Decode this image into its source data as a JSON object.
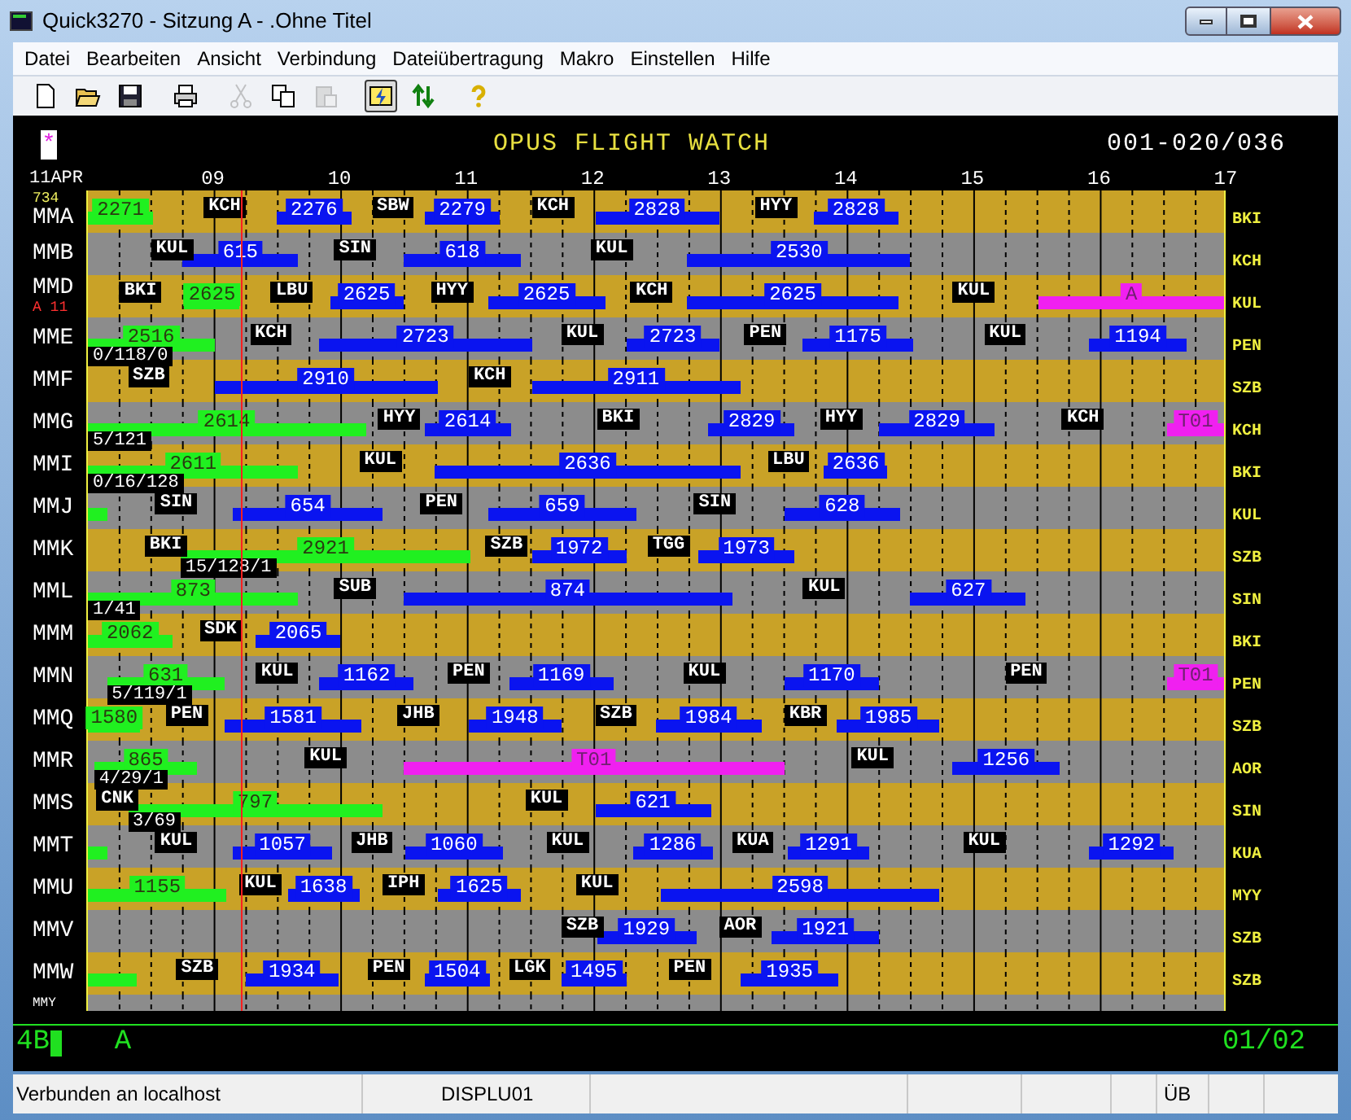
{
  "window": {
    "title": "Quick3270 - Sitzung A - .Ohne Titel"
  },
  "menu": [
    "Datei",
    "Bearbeiten",
    "Ansicht",
    "Verbindung",
    "Dateiübertragung",
    "Makro",
    "Einstellen",
    "Hilfe"
  ],
  "toolbar": [
    [
      {
        "kind": "new",
        "disabled": false,
        "selected": false
      },
      {
        "kind": "open",
        "disabled": false,
        "selected": false
      },
      {
        "kind": "save",
        "disabled": false,
        "selected": false
      }
    ],
    [
      {
        "kind": "print",
        "disabled": false,
        "selected": false
      }
    ],
    [
      {
        "kind": "cut",
        "disabled": true,
        "selected": false
      },
      {
        "kind": "copy",
        "disabled": false,
        "selected": false
      },
      {
        "kind": "paste",
        "disabled": true,
        "selected": false
      }
    ],
    [
      {
        "kind": "connect",
        "disabled": false,
        "selected": true
      },
      {
        "kind": "transfer",
        "disabled": false,
        "selected": false
      }
    ],
    [
      {
        "kind": "help",
        "disabled": false,
        "selected": false
      }
    ]
  ],
  "terminal": {
    "marker": "*",
    "title": "OPUS FLIGHT WATCH",
    "page_range": "001-020/036",
    "date": "11APR",
    "hours": [
      "09",
      "10",
      "11",
      "12",
      "13",
      "14",
      "15",
      "16",
      "17"
    ],
    "rows": [
      {
        "aircraft": "MMA",
        "note": {
          "kind": "count",
          "text": "734"
        },
        "destination": "BKI",
        "items": [
          {
            "kind": "active",
            "text": "2271"
          },
          {
            "kind": "station",
            "text": "KCH"
          },
          {
            "kind": "flight",
            "text": "2276"
          },
          {
            "kind": "station",
            "text": "SBW"
          },
          {
            "kind": "flight",
            "text": "2279"
          },
          {
            "kind": "station",
            "text": "KCH"
          },
          {
            "kind": "flight",
            "text": "2828"
          },
          {
            "kind": "station",
            "text": "HYY"
          },
          {
            "kind": "flight",
            "text": "2828"
          }
        ]
      },
      {
        "aircraft": "MMB",
        "destination": "KCH",
        "items": [
          {
            "kind": "station",
            "text": "KUL"
          },
          {
            "kind": "flight",
            "text": "615"
          },
          {
            "kind": "station",
            "text": "SIN"
          },
          {
            "kind": "flight",
            "text": "618"
          },
          {
            "kind": "station",
            "text": "KUL"
          },
          {
            "kind": "flight",
            "text": "2530"
          }
        ]
      },
      {
        "aircraft": "MMD",
        "note": {
          "kind": "alert",
          "text": "A 11"
        },
        "destination": "KUL",
        "items": [
          {
            "kind": "station",
            "text": "BKI"
          },
          {
            "kind": "active",
            "text": "2625"
          },
          {
            "kind": "station",
            "text": "LBU"
          },
          {
            "kind": "flight",
            "text": "2625"
          },
          {
            "kind": "station",
            "text": "HYY"
          },
          {
            "kind": "flight",
            "text": "2625"
          },
          {
            "kind": "station",
            "text": "KCH"
          },
          {
            "kind": "flight",
            "text": "2625"
          },
          {
            "kind": "station",
            "text": "KUL"
          },
          {
            "kind": "hold",
            "text": "A"
          }
        ]
      },
      {
        "aircraft": "MME",
        "destination": "PEN",
        "items": [
          {
            "kind": "active",
            "text": "2516",
            "sub": "0/118/0"
          },
          {
            "kind": "station",
            "text": "KCH"
          },
          {
            "kind": "flight",
            "text": "2723"
          },
          {
            "kind": "station",
            "text": "KUL"
          },
          {
            "kind": "flight",
            "text": "2723"
          },
          {
            "kind": "station",
            "text": "PEN"
          },
          {
            "kind": "flight",
            "text": "1175"
          },
          {
            "kind": "station",
            "text": "KUL"
          },
          {
            "kind": "flight",
            "text": "1194"
          }
        ]
      },
      {
        "aircraft": "MMF",
        "destination": "SZB",
        "items": [
          {
            "kind": "station",
            "text": "SZB"
          },
          {
            "kind": "flight",
            "text": "2910"
          },
          {
            "kind": "station",
            "text": "KCH"
          },
          {
            "kind": "flight",
            "text": "2911"
          }
        ]
      },
      {
        "aircraft": "MMG",
        "destination": "KCH",
        "items": [
          {
            "kind": "active",
            "text": "2614",
            "sub": "5/121"
          },
          {
            "kind": "station",
            "text": "HYY"
          },
          {
            "kind": "flight",
            "text": "2614"
          },
          {
            "kind": "station",
            "text": "BKI"
          },
          {
            "kind": "flight",
            "text": "2829"
          },
          {
            "kind": "station",
            "text": "HYY"
          },
          {
            "kind": "flight",
            "text": "2829"
          },
          {
            "kind": "station",
            "text": "KCH"
          },
          {
            "kind": "hold",
            "text": "T01"
          }
        ]
      },
      {
        "aircraft": "MMI",
        "destination": "BKI",
        "items": [
          {
            "kind": "active",
            "text": "2611",
            "sub": "0/16/128"
          },
          {
            "kind": "station",
            "text": "KUL"
          },
          {
            "kind": "flight",
            "text": "2636"
          },
          {
            "kind": "station",
            "text": "LBU"
          },
          {
            "kind": "flight",
            "text": "2636"
          }
        ]
      },
      {
        "aircraft": "MMJ",
        "destination": "KUL",
        "items": [
          {
            "kind": "active"
          },
          {
            "kind": "station",
            "text": "SIN"
          },
          {
            "kind": "flight",
            "text": "654"
          },
          {
            "kind": "station",
            "text": "PEN"
          },
          {
            "kind": "flight",
            "text": "659"
          },
          {
            "kind": "station",
            "text": "SIN"
          },
          {
            "kind": "flight",
            "text": "628"
          }
        ]
      },
      {
        "aircraft": "MMK",
        "destination": "SZB",
        "items": [
          {
            "kind": "station",
            "text": "BKI"
          },
          {
            "kind": "active",
            "text": "2921",
            "sub": "15/128/1"
          },
          {
            "kind": "station",
            "text": "SZB"
          },
          {
            "kind": "flight",
            "text": "1972"
          },
          {
            "kind": "station",
            "text": "TGG"
          },
          {
            "kind": "flight",
            "text": "1973"
          }
        ]
      },
      {
        "aircraft": "MML",
        "destination": "SIN",
        "items": [
          {
            "kind": "active",
            "text": "873",
            "sub": "1/41"
          },
          {
            "kind": "station",
            "text": "SUB"
          },
          {
            "kind": "flight",
            "text": "874"
          },
          {
            "kind": "station",
            "text": "KUL"
          },
          {
            "kind": "flight",
            "text": "627"
          }
        ]
      },
      {
        "aircraft": "MMM",
        "destination": "BKI",
        "items": [
          {
            "kind": "active",
            "text": "2062"
          },
          {
            "kind": "station",
            "text": "SDK"
          },
          {
            "kind": "flight",
            "text": "2065"
          }
        ]
      },
      {
        "aircraft": "MMN",
        "destination": "PEN",
        "items": [
          {
            "kind": "active",
            "text": "631",
            "sub": "5/119/1"
          },
          {
            "kind": "station",
            "text": "KUL"
          },
          {
            "kind": "flight",
            "text": "1162"
          },
          {
            "kind": "station",
            "text": "PEN"
          },
          {
            "kind": "flight",
            "text": "1169"
          },
          {
            "kind": "station",
            "text": "KUL"
          },
          {
            "kind": "flight",
            "text": "1170"
          },
          {
            "kind": "station",
            "text": "PEN"
          },
          {
            "kind": "hold",
            "text": "T01"
          }
        ]
      },
      {
        "aircraft": "MMQ",
        "destination": "SZB",
        "items": [
          {
            "kind": "active",
            "text": "1580"
          },
          {
            "kind": "station",
            "text": "PEN"
          },
          {
            "kind": "flight",
            "text": "1581"
          },
          {
            "kind": "station",
            "text": "JHB"
          },
          {
            "kind": "flight",
            "text": "1948"
          },
          {
            "kind": "station",
            "text": "SZB"
          },
          {
            "kind": "flight",
            "text": "1984"
          },
          {
            "kind": "station",
            "text": "KBR"
          },
          {
            "kind": "flight",
            "text": "1985"
          }
        ]
      },
      {
        "aircraft": "MMR",
        "destination": "AOR",
        "items": [
          {
            "kind": "active",
            "text": "865",
            "sub": "4/29/1"
          },
          {
            "kind": "station",
            "text": "KUL"
          },
          {
            "kind": "hold",
            "text": "T01"
          },
          {
            "kind": "station",
            "text": "KUL"
          },
          {
            "kind": "flight",
            "text": "1256"
          }
        ]
      },
      {
        "aircraft": "MMS",
        "destination": "SIN",
        "items": [
          {
            "kind": "station",
            "text": "CNK"
          },
          {
            "kind": "active",
            "text": "797",
            "sub": "3/69"
          },
          {
            "kind": "station",
            "text": "KUL"
          },
          {
            "kind": "flight",
            "text": "621"
          }
        ]
      },
      {
        "aircraft": "MMT",
        "destination": "KUA",
        "items": [
          {
            "kind": "active"
          },
          {
            "kind": "station",
            "text": "KUL"
          },
          {
            "kind": "flight",
            "text": "1057"
          },
          {
            "kind": "station",
            "text": "JHB"
          },
          {
            "kind": "flight",
            "text": "1060"
          },
          {
            "kind": "station",
            "text": "KUL"
          },
          {
            "kind": "flight",
            "text": "1286"
          },
          {
            "kind": "station",
            "text": "KUA"
          },
          {
            "kind": "flight",
            "text": "1291"
          },
          {
            "kind": "station",
            "text": "KUL"
          },
          {
            "kind": "flight",
            "text": "1292"
          }
        ]
      },
      {
        "aircraft": "MMU",
        "destination": "MYY",
        "items": [
          {
            "kind": "active",
            "text": "1155"
          },
          {
            "kind": "station",
            "text": "KUL"
          },
          {
            "kind": "flight",
            "text": "1638"
          },
          {
            "kind": "station",
            "text": "IPH"
          },
          {
            "kind": "flight",
            "text": "1625"
          },
          {
            "kind": "station",
            "text": "KUL"
          },
          {
            "kind": "flight",
            "text": "2598"
          }
        ]
      },
      {
        "aircraft": "MMV",
        "destination": "SZB",
        "items": [
          {
            "kind": "station",
            "text": "SZB"
          },
          {
            "kind": "flight",
            "text": "1929"
          },
          {
            "kind": "station",
            "text": "AOR"
          },
          {
            "kind": "flight",
            "text": "1921"
          }
        ]
      },
      {
        "aircraft": "MMW",
        "destination": "SZB",
        "items": [
          {
            "kind": "active"
          },
          {
            "kind": "station",
            "text": "SZB"
          },
          {
            "kind": "flight",
            "text": "1934"
          },
          {
            "kind": "station",
            "text": "PEN"
          },
          {
            "kind": "flight",
            "text": "1504"
          },
          {
            "kind": "station",
            "text": "LGK"
          },
          {
            "kind": "flight",
            "text": "1495"
          },
          {
            "kind": "station",
            "text": "PEN"
          },
          {
            "kind": "flight",
            "text": "1935"
          }
        ]
      },
      {
        "aircraft": "MMY",
        "items": []
      }
    ],
    "input": "4B",
    "mode": "A",
    "page": "01/02"
  },
  "status_bar": [
    "Verbunden an localhost",
    "DISPLU01",
    "ÜB"
  ]
}
